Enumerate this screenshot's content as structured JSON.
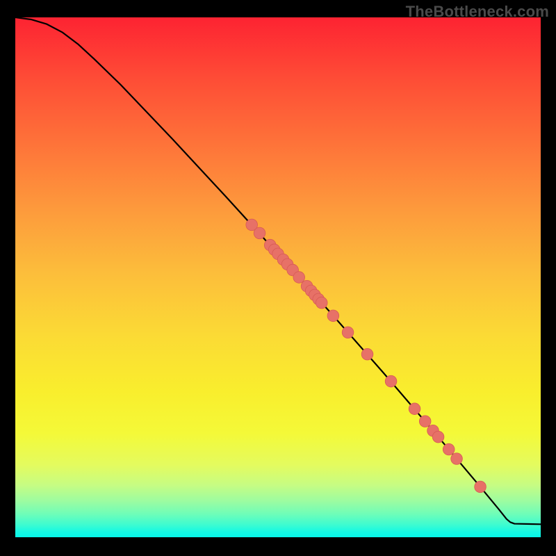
{
  "watermark": "TheBottleneck.com",
  "colors": {
    "page_bg": "#000000",
    "curve_stroke": "#000000",
    "marker_fill": "#e77167",
    "marker_stroke": "#d85b54",
    "watermark_text": "#4a4a4a"
  },
  "chart_data": {
    "type": "line",
    "title": "",
    "xlabel": "",
    "ylabel": "",
    "xlim": [
      0,
      100
    ],
    "ylim": [
      0,
      100
    ],
    "grid": false,
    "legend": false,
    "curve": [
      {
        "x": 0,
        "y": 100
      },
      {
        "x": 3,
        "y": 99.6
      },
      {
        "x": 6,
        "y": 98.7
      },
      {
        "x": 9,
        "y": 97.1
      },
      {
        "x": 12,
        "y": 94.8
      },
      {
        "x": 15,
        "y": 92.0
      },
      {
        "x": 20,
        "y": 87.1
      },
      {
        "x": 30,
        "y": 76.5
      },
      {
        "x": 40,
        "y": 65.6
      },
      {
        "x": 50,
        "y": 54.5
      },
      {
        "x": 60,
        "y": 43.2
      },
      {
        "x": 70,
        "y": 31.7
      },
      {
        "x": 80,
        "y": 19.9
      },
      {
        "x": 88,
        "y": 10.3
      },
      {
        "x": 92,
        "y": 5.4
      },
      {
        "x": 93.5,
        "y": 3.5
      },
      {
        "x": 94.2,
        "y": 2.9
      },
      {
        "x": 95.0,
        "y": 2.6
      },
      {
        "x": 100,
        "y": 2.5
      }
    ],
    "markers": [
      {
        "x": 45.0,
        "y": 60.1
      },
      {
        "x": 46.5,
        "y": 58.5
      },
      {
        "x": 48.5,
        "y": 56.2
      },
      {
        "x": 49.3,
        "y": 55.3
      },
      {
        "x": 50.0,
        "y": 54.5
      },
      {
        "x": 51.0,
        "y": 53.4
      },
      {
        "x": 51.8,
        "y": 52.5
      },
      {
        "x": 52.8,
        "y": 51.4
      },
      {
        "x": 54.0,
        "y": 50.0
      },
      {
        "x": 55.5,
        "y": 48.3
      },
      {
        "x": 56.3,
        "y": 47.4
      },
      {
        "x": 57.0,
        "y": 46.6
      },
      {
        "x": 57.7,
        "y": 45.8
      },
      {
        "x": 58.3,
        "y": 45.1
      },
      {
        "x": 60.5,
        "y": 42.6
      },
      {
        "x": 63.3,
        "y": 39.4
      },
      {
        "x": 67.0,
        "y": 35.2
      },
      {
        "x": 71.5,
        "y": 30.0
      },
      {
        "x": 76.0,
        "y": 24.7
      },
      {
        "x": 78.0,
        "y": 22.3
      },
      {
        "x": 79.5,
        "y": 20.5
      },
      {
        "x": 80.5,
        "y": 19.3
      },
      {
        "x": 82.5,
        "y": 16.9
      },
      {
        "x": 84.0,
        "y": 15.1
      },
      {
        "x": 88.5,
        "y": 9.7
      }
    ],
    "marker_radius_data_units": 1.1
  }
}
